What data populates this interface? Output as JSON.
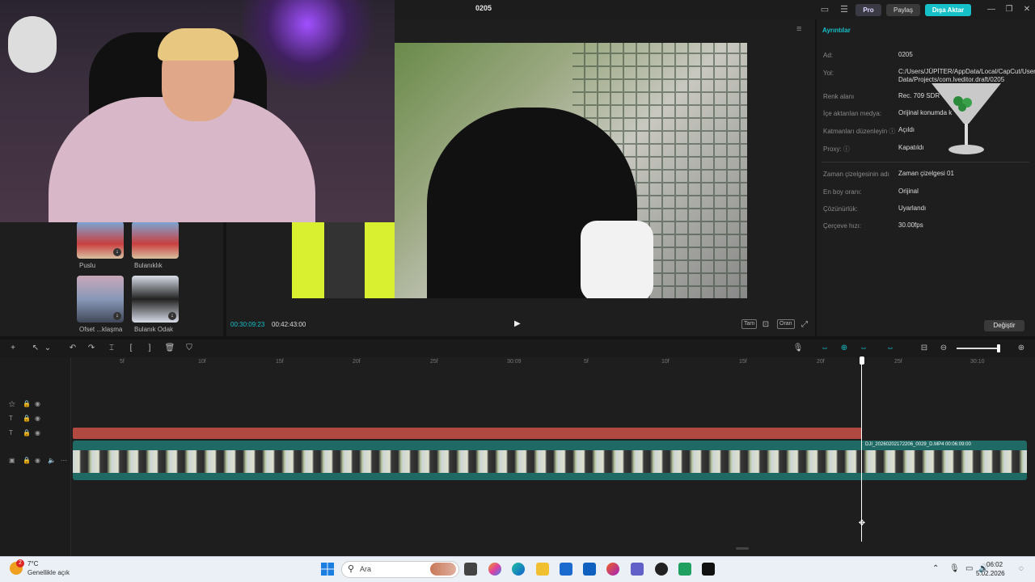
{
  "window": {
    "title": "0205",
    "pro_label": "Pro",
    "share_label": "Paylaş",
    "export_label": "Dışa Aktar"
  },
  "media_panel": {
    "items": [
      {
        "label": "Puslu"
      },
      {
        "label": "Bulanıklık"
      },
      {
        "label": "Ofset ...klaşma"
      },
      {
        "label": "Bulanık Odak"
      }
    ]
  },
  "player": {
    "current_time": "00:30:09:23",
    "total_time": "00:42:43:00",
    "controls": {
      "full": "Tam",
      "ratio": "Oran"
    }
  },
  "details": {
    "tab": "Ayrıntılar",
    "rows": [
      {
        "label": "Ad:",
        "value": "0205"
      },
      {
        "label": "Yol:",
        "value": "C:/Users/JÜPİTER/AppData/Local/CapCut/User Data/Projects/com.lveditor.draft/0205"
      },
      {
        "label": "Renk alanı",
        "value": "Rec. 709 SDR"
      },
      {
        "label": "İçe aktarılan medya:",
        "value": "Orijinal konumda k"
      },
      {
        "label": "Katmanları düzenleyin ⓘ",
        "value": "Açıldı"
      },
      {
        "label": "Proxy: ⓘ",
        "value": "Kapatıldı"
      },
      {
        "label": "Zaman çizelgesinin adı",
        "value": "Zaman çizelgesi 01"
      },
      {
        "label": "En boy oranı:",
        "value": "Orijinal"
      },
      {
        "label": "Çözünürlük:",
        "value": "Uyarlandı"
      },
      {
        "label": "Çerçeve hızı:",
        "value": "30.00fps"
      }
    ],
    "change_button": "Değiştir"
  },
  "timeline": {
    "ruler": [
      "5f",
      "10f",
      "15f",
      "20f",
      "25f",
      "30:09",
      "5f",
      "10f",
      "15f",
      "20f",
      "25f",
      "30:10"
    ],
    "clip_label": "DJI_20260202172206_0029_D.MP4  00:06:09:00"
  },
  "taskbar": {
    "weather_temp": "7°C",
    "weather_desc": "Genellikle açık",
    "weather_badge": "2",
    "search_placeholder": "Ara",
    "time": "06:02",
    "date": "5.02.2026"
  }
}
